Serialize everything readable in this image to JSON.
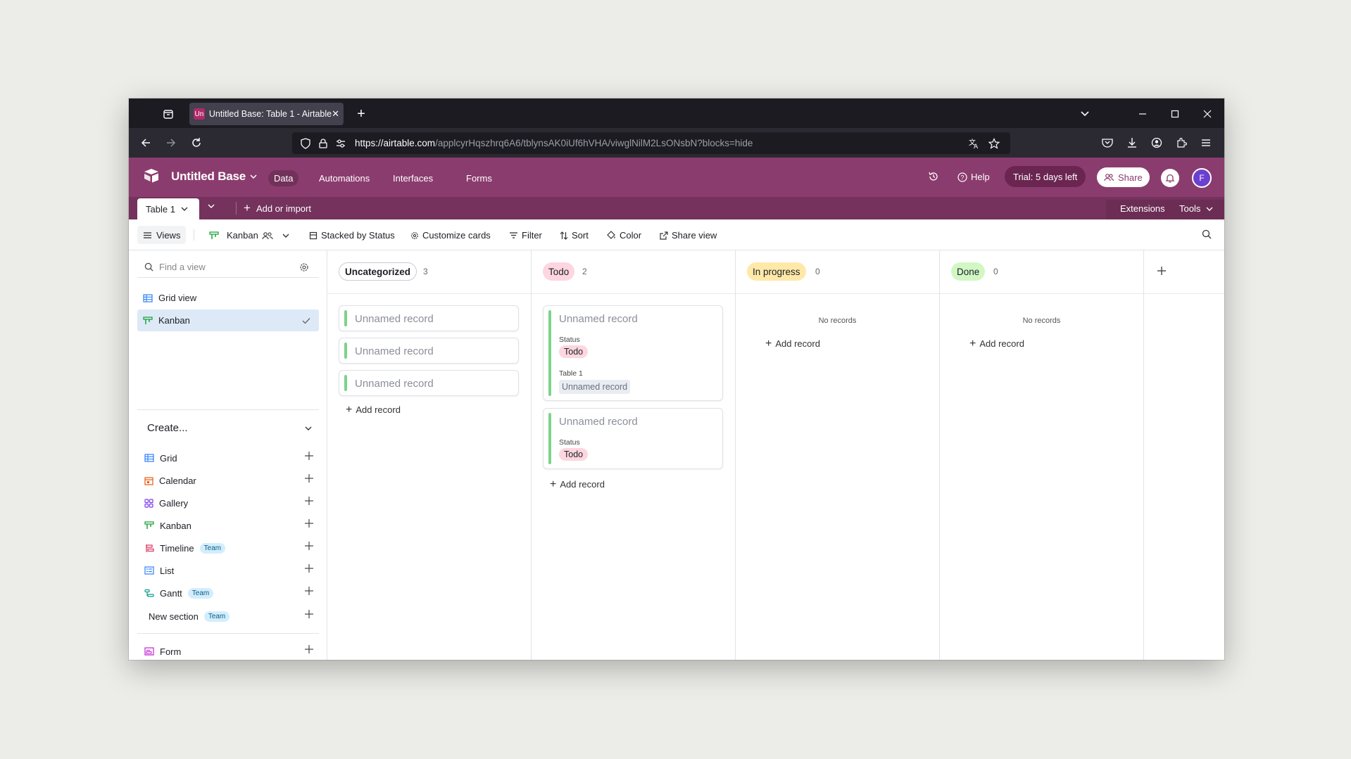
{
  "browser": {
    "tab_title": "Untitled Base: Table 1 - Airtable",
    "favicon_text": "Un",
    "url_host": "https://airtable.com",
    "url_path": "/applcyrHqszhrq6A6/tblynsAK0iUf6hVHA/viwglNilM2LsONsbN?blocks=hide"
  },
  "header": {
    "base_name": "Untitled Base",
    "nav": [
      "Data",
      "Automations",
      "Interfaces",
      "Forms"
    ],
    "help": "Help",
    "trial": "Trial: 5 days left",
    "share": "Share",
    "avatar": "F",
    "brand_color": "#8b3c6e"
  },
  "tablebar": {
    "table_name": "Table 1",
    "add_or_import": "Add or import",
    "extensions": "Extensions",
    "tools": "Tools"
  },
  "toolbar": {
    "views": "Views",
    "view_name": "Kanban",
    "stacked": "Stacked by Status",
    "customize": "Customize cards",
    "filter": "Filter",
    "sort": "Sort",
    "color": "Color",
    "share_view": "Share view"
  },
  "sidebar": {
    "find_placeholder": "Find a view",
    "views": [
      {
        "label": "Grid view",
        "icon": "grid-icon"
      },
      {
        "label": "Kanban",
        "icon": "kanban-icon",
        "selected": true
      }
    ],
    "create_label": "Create...",
    "create_items": [
      {
        "label": "Grid",
        "icon": "grid-icon"
      },
      {
        "label": "Calendar",
        "icon": "calendar-icon"
      },
      {
        "label": "Gallery",
        "icon": "gallery-icon"
      },
      {
        "label": "Kanban",
        "icon": "kanban-icon"
      },
      {
        "label": "Timeline",
        "icon": "timeline-icon",
        "badge": "Team"
      },
      {
        "label": "List",
        "icon": "list-icon"
      },
      {
        "label": "Gantt",
        "icon": "gantt-icon",
        "badge": "Team"
      },
      {
        "label": "New section",
        "badge": "Team"
      },
      {
        "label": "Form",
        "icon": "form-icon"
      }
    ]
  },
  "board": {
    "add_record": "Add record",
    "no_records": "No records",
    "columns": [
      {
        "name": "Uncategorized",
        "count": "3",
        "cards": [
          "Unnamed record",
          "Unnamed record",
          "Unnamed record"
        ]
      },
      {
        "name": "Todo",
        "count": "2",
        "cards": [
          {
            "title": "Unnamed record",
            "status_label": "Status",
            "status": "Todo",
            "link_label": "Table 1",
            "link_value": "Unnamed record"
          },
          {
            "title": "Unnamed record",
            "status_label": "Status",
            "status": "Todo"
          }
        ]
      },
      {
        "name": "In progress",
        "count": "0"
      },
      {
        "name": "Done",
        "count": "0"
      }
    ]
  }
}
